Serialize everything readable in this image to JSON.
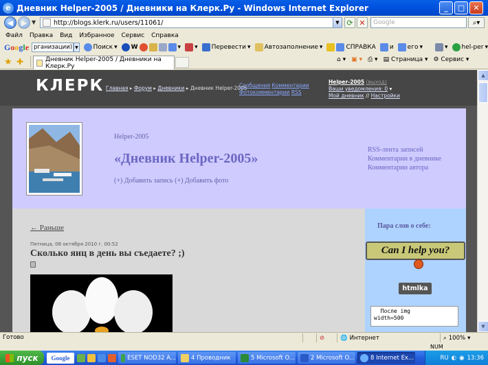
{
  "window": {
    "title": "Дневник Helper-2005 / Дневники на Клерк.Ру - Windows Internet Explorer",
    "app_icon": "ie-icon"
  },
  "address": {
    "url": "http://blogs.klerk.ru/users/11061/",
    "search_placeholder": "Google"
  },
  "menu": [
    "Файл",
    "Правка",
    "Вид",
    "Избранное",
    "Сервис",
    "Справка"
  ],
  "google_toolbar": {
    "logo": [
      "G",
      "o",
      "o",
      "g",
      "l",
      "e"
    ],
    "search_value": "рганизации) бланк",
    "search_label": "Поиск",
    "translate_label": "Перевести",
    "autofill_label": "Автозаполнение",
    "ref_label": "СПРАВКА",
    "and_label": "и",
    "ero_label": "его",
    "user_label": "hel-per"
  },
  "tabs": {
    "active_label": "Дневник Helper-2005 / Дневники на Клерк.Ру",
    "page_label": "Страница",
    "service_label": "Сервис"
  },
  "site": {
    "logo": "КЛЕРК",
    "breadcrumb": {
      "home": "Главная",
      "forum": "Форум",
      "diaries": "Дневники",
      "current": "Дневник Helper-2005"
    },
    "topnav": {
      "messages": "Сообщения",
      "comments": "Комментарии",
      "photo_comments": "Фотокомментарии",
      "rss": "RSS"
    },
    "user": {
      "name": "Helper-2005",
      "logout": "(выход)",
      "notifications": "Ваши уведомления: 0",
      "my_diary": "Мой дневник",
      "separator": "//",
      "settings": "Настройки"
    }
  },
  "blog": {
    "owner": "Helper-2005",
    "title": "«Дневник Helper-2005»",
    "add_post": "(+) Добавить запись",
    "add_photo": "(+) Добавить фото",
    "links": [
      "RSS-лента записей",
      "Комментарии в дневнике",
      "Комментарии автора"
    ]
  },
  "post": {
    "prev_link": "← Раньше",
    "date": "Пятница, 08 октября 2010 г. 00:52",
    "title": "Сколько яиц в день вы съедаете? ;)"
  },
  "sidebar": {
    "about_title": "Пара слов о себе:",
    "sign_text": "Can I help you?",
    "button_label": "htmlka",
    "code_text": "  После img\nwidth=500"
  },
  "status": {
    "text": "Готово",
    "zone": "Интернет",
    "zoom": "100%",
    "num": "NUM"
  },
  "taskbar": {
    "start": "пуск",
    "google": "Google",
    "items": [
      {
        "label": "ESET NOD32 A...",
        "icon": "eset-icon"
      },
      {
        "label": "4 Проводник",
        "icon": "folder-icon"
      },
      {
        "label": "5 Microsoft O...",
        "icon": "excel-icon"
      },
      {
        "label": "2 Microsoft O...",
        "icon": "word-icon"
      },
      {
        "label": "8 Internet Ex...",
        "icon": "ie-icon"
      }
    ],
    "lang": "RU",
    "clock": "13:36"
  }
}
